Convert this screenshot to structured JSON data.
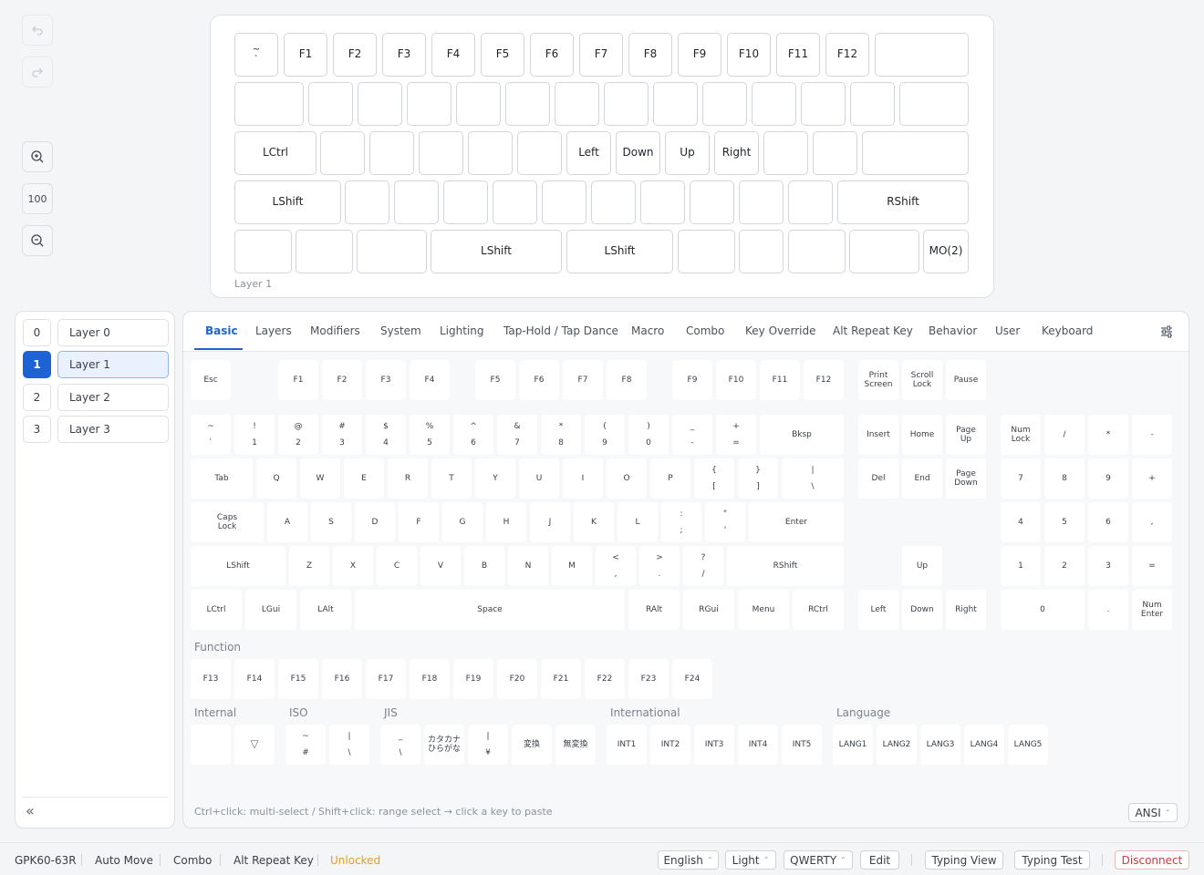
{
  "history": {
    "undo_icon": "undo-icon",
    "redo_icon": "redo-icon"
  },
  "zoom": {
    "level": "100",
    "in_icon": "zoom-in-icon",
    "out_icon": "zoom-out-icon"
  },
  "preview": {
    "layer_label": "Layer 1",
    "keys": [
      "~\n`",
      "F1",
      "F2",
      "F3",
      "F4",
      "F5",
      "F6",
      "F7",
      "F8",
      "F9",
      "F10",
      "F11",
      "F12",
      "",
      "",
      "",
      "",
      "",
      "",
      "",
      "",
      "",
      "",
      "",
      "",
      "",
      "",
      "",
      "LCtrl",
      "",
      "",
      "",
      "",
      "",
      "Left",
      "Down",
      "Up",
      "Right",
      "",
      "",
      "",
      "LShift",
      "",
      "",
      "",
      "",
      "",
      "",
      "",
      "",
      "",
      "",
      "RShift",
      "",
      "",
      "",
      "LShift",
      "LShift",
      "",
      "",
      "",
      "",
      "MO(2)"
    ]
  },
  "layers": {
    "items": [
      {
        "num": "0",
        "name": "Layer 0"
      },
      {
        "num": "1",
        "name": "Layer 1"
      },
      {
        "num": "2",
        "name": "Layer 2"
      },
      {
        "num": "3",
        "name": "Layer 3"
      }
    ],
    "selected": 1,
    "collapse_label": "«"
  },
  "tabs": [
    "Basic",
    "Layers",
    "Modifiers",
    "System",
    "Lighting",
    "Tap-Hold / Tap Dance",
    "Macro",
    "Combo",
    "Key Override",
    "Alt Repeat Key",
    "Behavior",
    "User",
    "Keyboard"
  ],
  "active_tab": "Basic",
  "settings_icon": "sliders-icon",
  "palette": {
    "keys": [
      "Esc",
      "F1",
      "F2",
      "F3",
      "F4",
      "F5",
      "F6",
      "F7",
      "F8",
      "F9",
      "F10",
      "F11",
      "F12",
      "Print\nScreen",
      "Scroll\nLock",
      "Pause",
      "~\n`",
      "!\n1",
      "@\n2",
      "#\n3",
      "$\n4",
      "%\n5",
      "^\n6",
      "&\n7",
      "*\n8",
      "(\n9",
      ")\n0",
      "_\n-",
      "+\n=",
      "Bksp",
      "Insert",
      "Home",
      "Page\nUp",
      "Num\nLock",
      "/",
      "*",
      "-",
      "Tab",
      "Q",
      "W",
      "E",
      "R",
      "T",
      "Y",
      "U",
      "I",
      "O",
      "P",
      "{\n[",
      "}\n]",
      "|\n\\",
      "Del",
      "End",
      "Page\nDown",
      "7",
      "8",
      "9",
      "+",
      "Caps\nLock",
      "A",
      "S",
      "D",
      "F",
      "G",
      "H",
      "J",
      "K",
      "L",
      ":\n;",
      "\"\n'",
      "Enter",
      "4",
      "5",
      "6",
      ",",
      "LShift",
      "Z",
      "X",
      "C",
      "V",
      "B",
      "N",
      "M",
      "<\n,",
      ">\n.",
      "?\n/",
      "RShift",
      "Up",
      "1",
      "2",
      "3",
      "=",
      "LCtrl",
      "LGui",
      "LAlt",
      "Space",
      "RAlt",
      "RGui",
      "Menu",
      "RCtrl",
      "Left",
      "Down",
      "Right",
      "0",
      ".",
      "Num\nEnter"
    ],
    "function_label": "Function",
    "function_keys": [
      "F13",
      "F14",
      "F15",
      "F16",
      "F17",
      "F18",
      "F19",
      "F20",
      "F21",
      "F22",
      "F23",
      "F24"
    ],
    "internal_label": "Internal",
    "iso_label": "ISO",
    "jis_label": "JIS",
    "international_label": "International",
    "language_label": "Language",
    "extra_keys": [
      "",
      "▽",
      "~\n#",
      "|\n\\",
      "_\n\\",
      "カタカナ\nひらがな",
      "|\n¥",
      "変換",
      "無変換",
      "INT1",
      "INT2",
      "INT3",
      "INT4",
      "INT5",
      "LANG1",
      "LANG2",
      "LANG3",
      "LANG4",
      "LANG5"
    ],
    "hint": "Ctrl+click: multi-select / Shift+click: range select → click a key to paste",
    "layout_select": "ANSI"
  },
  "statusbar": {
    "device": "GPK60-63R",
    "auto_move": "Auto Move",
    "combo": "Combo",
    "alt_repeat": "Alt Repeat Key",
    "lock_status": "Unlocked",
    "language": "English",
    "theme": "Light",
    "keymap": "QWERTY",
    "edit": "Edit",
    "typing_view": "Typing View",
    "typing_test": "Typing Test",
    "disconnect": "Disconnect"
  },
  "colors": {
    "accent": "#1e63d6",
    "unlocked": "#e0a020",
    "disconnect": "#d9363e"
  }
}
